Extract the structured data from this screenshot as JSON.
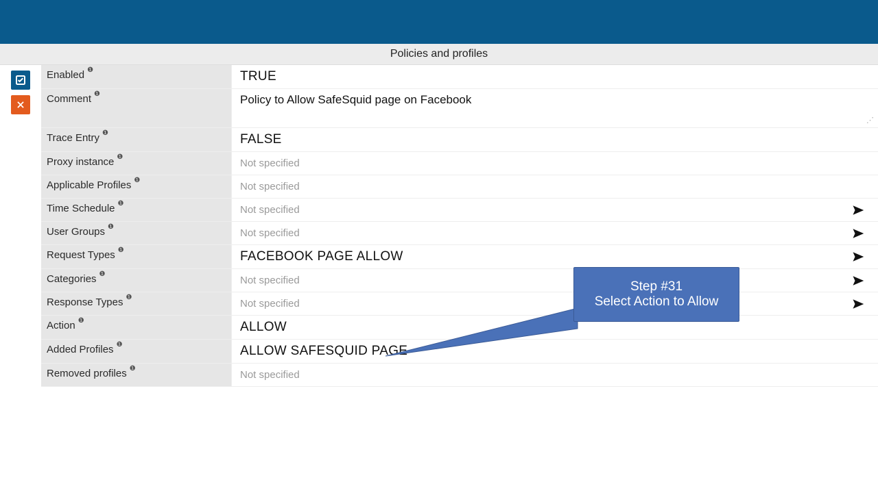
{
  "section_title": "Policies and profiles",
  "rows": {
    "enabled": {
      "label": "Enabled",
      "value": "TRUE"
    },
    "comment": {
      "label": "Comment",
      "value": "Policy to Allow SafeSquid page on Facebook"
    },
    "trace_entry": {
      "label": "Trace Entry",
      "value": "FALSE"
    },
    "proxy_instance": {
      "label": "Proxy instance",
      "value": "Not specified"
    },
    "applicable_profiles": {
      "label": "Applicable Profiles",
      "value": "Not specified"
    },
    "time_schedule": {
      "label": "Time Schedule",
      "value": "Not specified"
    },
    "user_groups": {
      "label": "User Groups",
      "value": "Not specified"
    },
    "request_types": {
      "label": "Request Types",
      "value": "FACEBOOK PAGE ALLOW"
    },
    "categories": {
      "label": "Categories",
      "value": "Not specified"
    },
    "response_types": {
      "label": "Response Types",
      "value": "Not specified"
    },
    "action": {
      "label": "Action",
      "value": "ALLOW"
    },
    "added_profiles": {
      "label": "Added Profiles",
      "value": "ALLOW SAFESQUID PAGE"
    },
    "removed_profiles": {
      "label": "Removed profiles",
      "value": "Not specified"
    }
  },
  "callout": {
    "line1": "Step #31",
    "line2": "Select Action to Allow"
  }
}
